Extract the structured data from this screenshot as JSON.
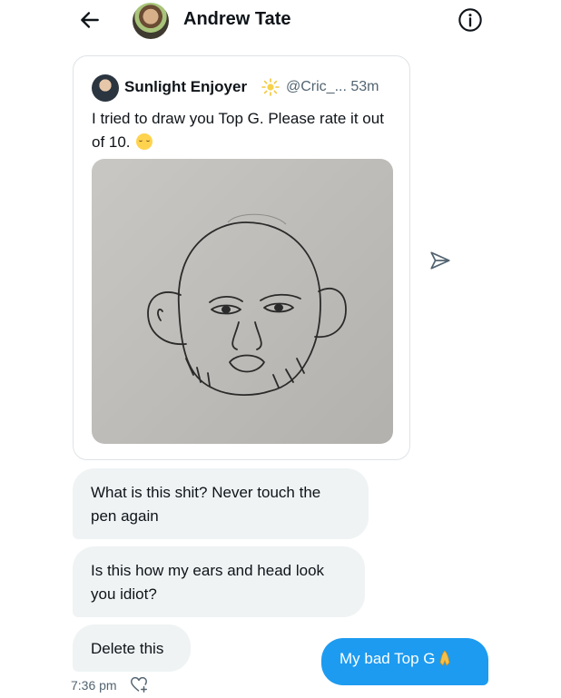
{
  "header": {
    "back_icon": "arrow-left-icon",
    "contact_name": "Andrew Tate",
    "info_icon": "info-icon"
  },
  "quoted_tweet": {
    "author_name": "Sunlight Enjoyer",
    "badge_icon": "sun-icon",
    "handle_time": "@Cric_... 53m",
    "text": "I tried to draw you Top G. Please rate it out of 10.",
    "emoji_icon": "relieved-face-icon",
    "image": "pencil-drawing-of-face"
  },
  "actions": {
    "share_icon": "send-icon"
  },
  "messages": {
    "received": [
      "What is this shit? Never touch the pen again",
      "Is this how my ears and head look you idiot?",
      "Delete this"
    ],
    "sent": "My bad Top G",
    "sent_emoji_icon": "folded-hands-icon",
    "timestamp": "7:36 pm",
    "react_icon": "heart-plus-icon"
  },
  "colors": {
    "accent": "#1d9bf0",
    "bubble_in": "#eff3f4",
    "secondary_text": "#536471"
  }
}
